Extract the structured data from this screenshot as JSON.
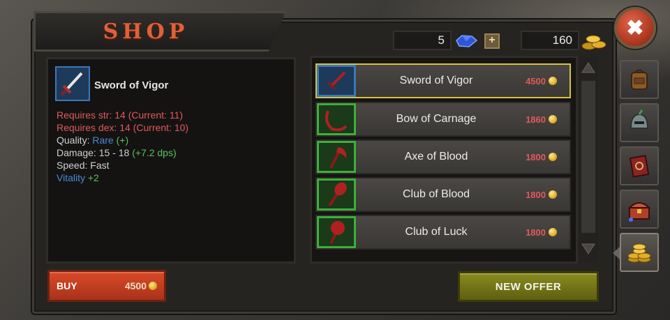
{
  "shop": {
    "title": "SHOP",
    "currency": {
      "gems": "5",
      "plus_label": "+",
      "gold": "160"
    },
    "close_label": "✖"
  },
  "selected_item": {
    "name": "Sword of Vigor",
    "stats": {
      "req_str": "Requires str: 14 (Current: 11)",
      "req_dex": "Requires dex: 14 (Current: 10)",
      "quality_label": "Quality:",
      "quality_value": "Rare",
      "quality_extra": "(+)",
      "damage_label": "Damage: 15 - 18",
      "damage_extra": "(+7.2 dps)",
      "speed": "Speed: Fast",
      "vitality_label": "Vitality",
      "vitality_value": "+2"
    }
  },
  "buy": {
    "label": "BUY",
    "price": "4500"
  },
  "items": [
    {
      "name": "Sword of Vigor",
      "price": "4500",
      "icon": "sword-icon",
      "selected": true
    },
    {
      "name": "Bow of Carnage",
      "price": "1860",
      "icon": "bow-icon",
      "selected": false
    },
    {
      "name": "Axe of Blood",
      "price": "1800",
      "icon": "axe-icon",
      "selected": false
    },
    {
      "name": "Club of Blood",
      "price": "1800",
      "icon": "club-icon",
      "selected": false
    },
    {
      "name": "Club of Luck",
      "price": "1800",
      "icon": "club-icon",
      "selected": false
    }
  ],
  "new_offer_label": "NEW OFFER",
  "side_tabs": [
    {
      "icon": "backpack-icon",
      "active": false
    },
    {
      "icon": "helmet-icon",
      "active": false
    },
    {
      "icon": "spellbook-icon",
      "active": false
    },
    {
      "icon": "treasure-chest-icon",
      "active": false
    },
    {
      "icon": "coin-stack-icon",
      "active": true
    }
  ],
  "colors": {
    "accent_title": "#e0603a",
    "price_red": "#e05a5a",
    "rarity_blue": "#4a8ad8",
    "bonus_green": "#5cc05c",
    "selected_border": "#d8c33a"
  }
}
